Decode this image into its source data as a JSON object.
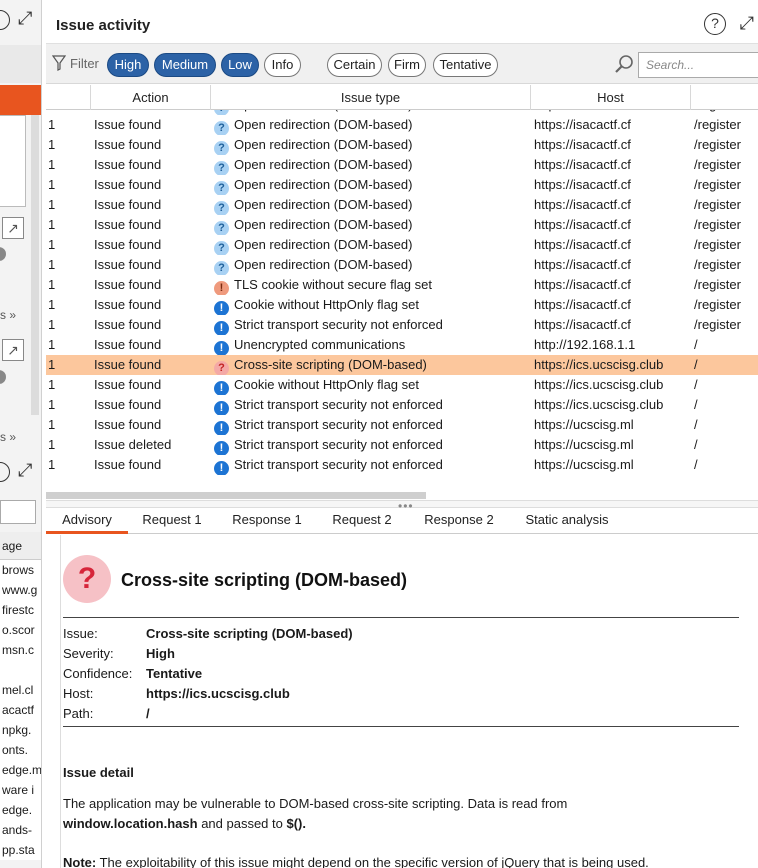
{
  "panel": {
    "title": "Issue activity",
    "help_icon": "help-icon",
    "expand_icon": "expand-icon"
  },
  "filter": {
    "label": "Filter",
    "severity_chips": [
      {
        "label": "High",
        "active": true
      },
      {
        "label": "Medium",
        "active": true
      },
      {
        "label": "Low",
        "active": true
      },
      {
        "label": "Info",
        "active": false
      }
    ],
    "confidence_chips": [
      {
        "label": "Certain",
        "active": false
      },
      {
        "label": "Firm",
        "active": false
      },
      {
        "label": "Tentative",
        "active": false
      }
    ],
    "search_placeholder": "Search..."
  },
  "table": {
    "columns": [
      "Action",
      "Issue type",
      "Host"
    ],
    "rows": [
      {
        "num": "1",
        "action": "Issue found",
        "severity": "info",
        "type": "Open redirection (DOM-based)",
        "host": "https://isacactf.cf",
        "path": "/register"
      },
      {
        "num": "1",
        "action": "Issue found",
        "severity": "info",
        "type": "Open redirection (DOM-based)",
        "host": "https://isacactf.cf",
        "path": "/register"
      },
      {
        "num": "1",
        "action": "Issue found",
        "severity": "info",
        "type": "Open redirection (DOM-based)",
        "host": "https://isacactf.cf",
        "path": "/register"
      },
      {
        "num": "1",
        "action": "Issue found",
        "severity": "info",
        "type": "Open redirection (DOM-based)",
        "host": "https://isacactf.cf",
        "path": "/register"
      },
      {
        "num": "1",
        "action": "Issue found",
        "severity": "info",
        "type": "Open redirection (DOM-based)",
        "host": "https://isacactf.cf",
        "path": "/register"
      },
      {
        "num": "1",
        "action": "Issue found",
        "severity": "info",
        "type": "Open redirection (DOM-based)",
        "host": "https://isacactf.cf",
        "path": "/register"
      },
      {
        "num": "1",
        "action": "Issue found",
        "severity": "info",
        "type": "Open redirection (DOM-based)",
        "host": "https://isacactf.cf",
        "path": "/register"
      },
      {
        "num": "1",
        "action": "Issue found",
        "severity": "info",
        "type": "Open redirection (DOM-based)",
        "host": "https://isacactf.cf",
        "path": "/register"
      },
      {
        "num": "1",
        "action": "Issue found",
        "severity": "info",
        "type": "Open redirection (DOM-based)",
        "host": "https://isacactf.cf",
        "path": "/register"
      },
      {
        "num": "1",
        "action": "Issue found",
        "severity": "medium",
        "type": "TLS cookie without secure flag set",
        "host": "https://isacactf.cf",
        "path": "/register"
      },
      {
        "num": "1",
        "action": "Issue found",
        "severity": "low",
        "type": "Cookie without HttpOnly flag set",
        "host": "https://isacactf.cf",
        "path": "/register"
      },
      {
        "num": "1",
        "action": "Issue found",
        "severity": "low",
        "type": "Strict transport security not enforced",
        "host": "https://isacactf.cf",
        "path": "/register"
      },
      {
        "num": "1",
        "action": "Issue found",
        "severity": "low",
        "type": "Unencrypted communications",
        "host": "http://192.168.1.1",
        "path": "/"
      },
      {
        "num": "1",
        "action": "Issue found",
        "severity": "high",
        "type": "Cross-site scripting (DOM-based)",
        "host": "https://ics.ucscisg.club",
        "path": "/",
        "selected": true
      },
      {
        "num": "1",
        "action": "Issue found",
        "severity": "low",
        "type": "Cookie without HttpOnly flag set",
        "host": "https://ics.ucscisg.club",
        "path": "/"
      },
      {
        "num": "1",
        "action": "Issue found",
        "severity": "low",
        "type": "Strict transport security not enforced",
        "host": "https://ics.ucscisg.club",
        "path": "/"
      },
      {
        "num": "1",
        "action": "Issue found",
        "severity": "low",
        "type": "Strict transport security not enforced",
        "host": "https://ucscisg.ml",
        "path": "/"
      },
      {
        "num": "1",
        "action": "Issue deleted",
        "severity": "low",
        "type": "Strict transport security not enforced",
        "host": "https://ucscisg.ml",
        "path": "/"
      },
      {
        "num": "1",
        "action": "Issue found",
        "severity": "low",
        "type": "Strict transport security not enforced",
        "host": "https://ucscisg.ml",
        "path": "/"
      }
    ]
  },
  "tabs": [
    {
      "label": "Advisory",
      "active": true
    },
    {
      "label": "Request 1",
      "active": false
    },
    {
      "label": "Response 1",
      "active": false
    },
    {
      "label": "Request 2",
      "active": false
    },
    {
      "label": "Response 2",
      "active": false
    },
    {
      "label": "Static analysis",
      "active": false
    }
  ],
  "advisory": {
    "title": "Cross-site scripting (DOM-based)",
    "fields": [
      {
        "key": "Issue:",
        "value": "Cross-site scripting (DOM-based)"
      },
      {
        "key": "Severity:",
        "value": "High"
      },
      {
        "key": "Confidence:",
        "value": "Tentative"
      },
      {
        "key": "Host:",
        "value": "https://ics.ucscisg.club"
      },
      {
        "key": "Path:",
        "value": "/"
      }
    ],
    "detail_heading": "Issue detail",
    "detail_text_1": "The application may be vulnerable to DOM-based cross-site scripting. Data is read from",
    "detail_code_1": "window.location.hash",
    "detail_text_2": " and passed to ",
    "detail_code_2": "$().",
    "note_label": "Note:",
    "note_text": " The exploitability of this issue might depend on the specific version of jQuery that is being used."
  },
  "left_panel": {
    "more_label": "s",
    "list_header": "age",
    "list_items": [
      "brows",
      "www.g",
      "firestc",
      "o.scor",
      "msn.c",
      "",
      "mel.cl",
      "acactf",
      "npkg.",
      "onts.",
      "edge.m",
      "ware i",
      "edge.",
      "ands-",
      "pp.sta"
    ]
  },
  "colors": {
    "accent": "#e8551f",
    "chip_active": "#2c62a6",
    "selected_row": "#fcc79d"
  }
}
